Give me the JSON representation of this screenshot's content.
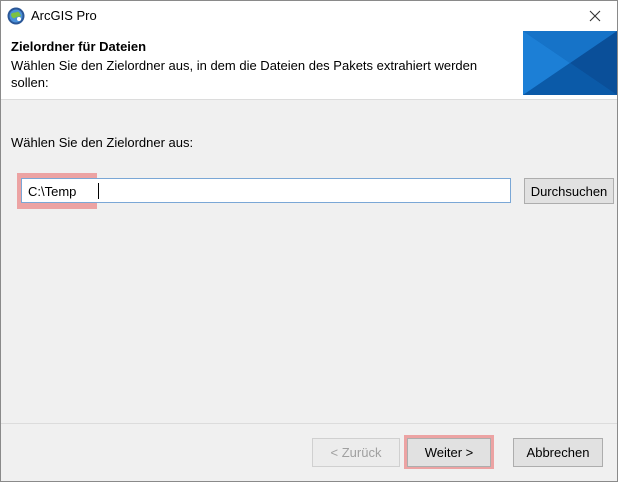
{
  "window": {
    "title": "ArcGIS Pro"
  },
  "header": {
    "title": "Zielordner für Dateien",
    "subtitle": "Wählen Sie den Zielordner aus, in dem die Dateien des Pakets extrahiert werden sollen:"
  },
  "main": {
    "folder_label": "Wählen Sie den Zielordner aus:",
    "folder_value": "C:\\Temp",
    "browse_label": "Durchsuchen"
  },
  "footer": {
    "back_label": "< Zurück",
    "next_label": "Weiter >",
    "cancel_label": "Abbrechen"
  },
  "colors": {
    "highlight": "#e96464",
    "accent": "#0078d4"
  }
}
